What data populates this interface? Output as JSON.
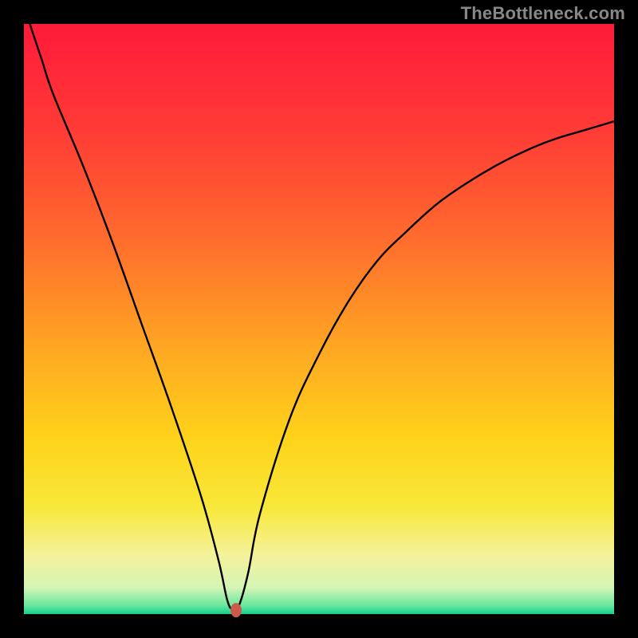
{
  "watermark": "TheBottleneck.com",
  "chart_data": {
    "type": "line",
    "title": "",
    "xlabel": "",
    "ylabel": "",
    "xlim": [
      0,
      100
    ],
    "ylim": [
      0,
      100
    ],
    "series": [
      {
        "name": "bottleneck-curve",
        "x": [
          1,
          3,
          5,
          10,
          15,
          20,
          25,
          30,
          33,
          34.5,
          35.5,
          36.5,
          38,
          40,
          45,
          50,
          55,
          60,
          65,
          70,
          75,
          80,
          85,
          90,
          95,
          100
        ],
        "values": [
          100,
          94,
          88,
          76,
          63,
          49,
          35,
          20,
          9,
          2.2,
          0.8,
          1.6,
          7,
          17,
          33,
          44,
          53,
          60,
          65,
          69.5,
          73,
          76,
          78.5,
          80.5,
          82,
          83.5
        ]
      }
    ],
    "marker": {
      "x": 36,
      "y": 0.6,
      "color": "#cc5a4b"
    },
    "gradient": {
      "stops": [
        {
          "pos": 0.0,
          "color": "#ff1a3a"
        },
        {
          "pos": 0.18,
          "color": "#ff3b36"
        },
        {
          "pos": 0.36,
          "color": "#ff6a2e"
        },
        {
          "pos": 0.54,
          "color": "#ffa423"
        },
        {
          "pos": 0.7,
          "color": "#ffd21a"
        },
        {
          "pos": 0.82,
          "color": "#f8e83a"
        },
        {
          "pos": 0.9,
          "color": "#f4f29a"
        },
        {
          "pos": 0.955,
          "color": "#d6f4b6"
        },
        {
          "pos": 0.985,
          "color": "#6be89e"
        },
        {
          "pos": 1.0,
          "color": "#12d18b"
        }
      ]
    },
    "curve_stroke": "#000000",
    "curve_width": 2.4
  }
}
